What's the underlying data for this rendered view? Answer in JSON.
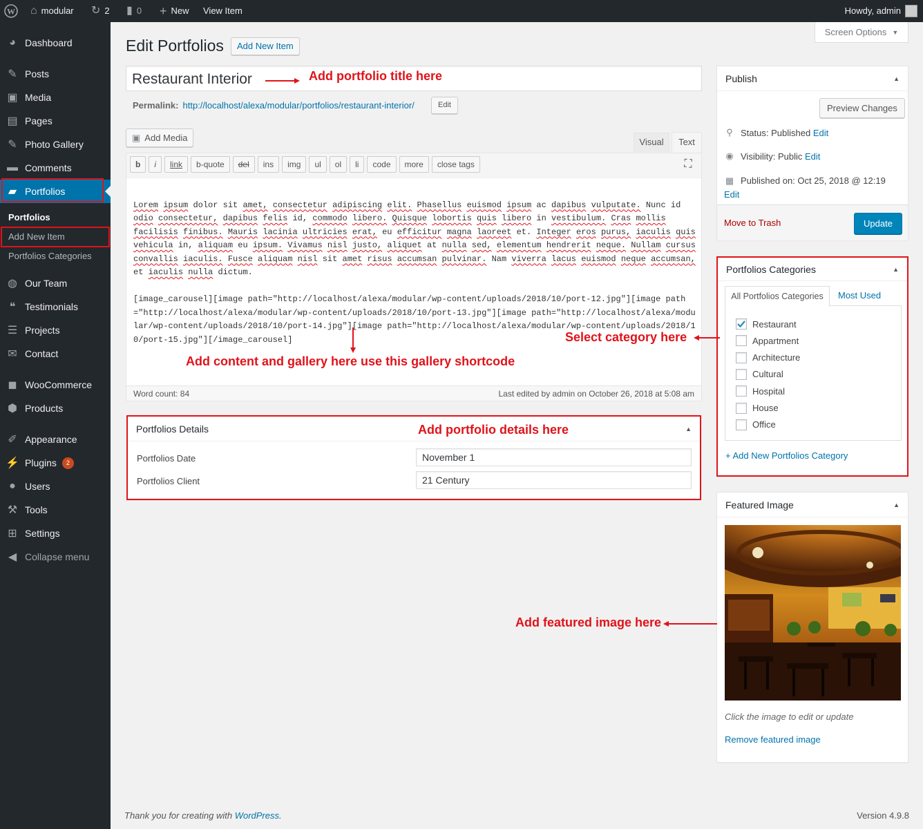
{
  "adminbar": {
    "site_name": "modular",
    "updates_count": "2",
    "comments_count": "0",
    "new_label": "New",
    "view_item_label": "View Item",
    "howdy": "Howdy, admin"
  },
  "sidebar": {
    "items": [
      {
        "label": "Dashboard",
        "icon": "dashboard-icon"
      },
      {
        "label": "Posts",
        "icon": "pin-icon"
      },
      {
        "label": "Media",
        "icon": "media-icon"
      },
      {
        "label": "Pages",
        "icon": "pages-icon"
      },
      {
        "label": "Photo Gallery",
        "icon": "pin-icon"
      },
      {
        "label": "Comments",
        "icon": "comment-icon"
      },
      {
        "label": "Portfolios",
        "icon": "folder-icon"
      },
      {
        "label": "Our Team",
        "icon": "team-icon"
      },
      {
        "label": "Testimonials",
        "icon": "quote-icon"
      },
      {
        "label": "Projects",
        "icon": "list-icon"
      },
      {
        "label": "Contact",
        "icon": "mail-icon"
      },
      {
        "label": "WooCommerce",
        "icon": "woo-icon"
      },
      {
        "label": "Products",
        "icon": "box-icon"
      },
      {
        "label": "Appearance",
        "icon": "brush-icon"
      },
      {
        "label": "Plugins",
        "icon": "plug-icon",
        "badge": "2"
      },
      {
        "label": "Users",
        "icon": "user-icon"
      },
      {
        "label": "Tools",
        "icon": "wrench-icon"
      },
      {
        "label": "Settings",
        "icon": "settings-icon"
      },
      {
        "label": "Collapse menu",
        "icon": "collapse-icon"
      }
    ],
    "submenu": [
      "Portfolios",
      "Add New Item",
      "Portfolios Categories"
    ]
  },
  "page": {
    "title": "Edit Portfolios",
    "add_new": "Add New Item",
    "screen_options": "Screen Options",
    "post_title": "Restaurant Interior",
    "permalink_label": "Permalink:",
    "permalink_base": "http://localhost/alexa/modular/portfolios/",
    "permalink_slug": "restaurant-interior",
    "permalink_end": "/",
    "permalink_edit": "Edit"
  },
  "editor": {
    "add_media": "Add Media",
    "tab_visual": "Visual",
    "tab_text": "Text",
    "quicktags": [
      "b",
      "i",
      "link",
      "b-quote",
      "del",
      "ins",
      "img",
      "ul",
      "ol",
      "li",
      "code",
      "more",
      "close tags"
    ],
    "paragraph": "Lorem ipsum dolor sit amet, consectetur adipiscing elit. Phasellus euismod ipsum ac dapibus vulputate. Nunc id odio consectetur, dapibus felis id, commodo libero. Quisque lobortis quis libero in vestibulum. Cras mollis facilisis finibus. Mauris lacinia ultricies erat, eu efficitur magna laoreet et. Integer eros purus, iaculis quis vehicula in, aliquam eu ipsum. Vivamus nisl justo, aliquet at nulla sed, elementum hendrerit neque. Nullam cursus convallis iaculis. Fusce aliquam nisl sit amet risus accumsan pulvinar. Nam viverra lacus euismod neque accumsan, et iaculis nulla dictum.",
    "shortcode": "[image_carousel][image path=\"http://localhost/alexa/modular/wp-content/uploads/2018/10/port-12.jpg\"][image path=\"http://localhost/alexa/modular/wp-content/uploads/2018/10/port-13.jpg\"][image path=\"http://localhost/alexa/modular/wp-content/uploads/2018/10/port-14.jpg\"][image path=\"http://localhost/alexa/modular/wp-content/uploads/2018/10/port-15.jpg\"][/image_carousel]",
    "word_count": "Word count: 84",
    "last_edited": "Last edited by admin on October 26, 2018 at 5:08 am"
  },
  "details": {
    "title": "Portfolios Details",
    "date_label": "Portfolios Date",
    "date_value": "November 1",
    "client_label": "Portfolios Client",
    "client_value": "21 Century"
  },
  "publish": {
    "title": "Publish",
    "preview": "Preview Changes",
    "status_label": "Status: ",
    "status_value": "Published",
    "visibility_label": "Visibility: ",
    "visibility_value": "Public",
    "published_label": "Published on: ",
    "published_value": "Oct 25, 2018 @ 12:19",
    "edit": "Edit",
    "trash": "Move to Trash",
    "update": "Update"
  },
  "categories": {
    "title": "Portfolios Categories",
    "tab_all": "All Portfolios Categories",
    "tab_most": "Most Used",
    "items": [
      {
        "label": "Restaurant",
        "checked": true
      },
      {
        "label": "Appartment",
        "checked": false
      },
      {
        "label": "Architecture",
        "checked": false
      },
      {
        "label": "Cultural",
        "checked": false
      },
      {
        "label": "Hospital",
        "checked": false
      },
      {
        "label": "House",
        "checked": false
      },
      {
        "label": "Office",
        "checked": false
      }
    ],
    "add_new": "+ Add New Portfolios Category"
  },
  "featured": {
    "title": "Featured Image",
    "hint": "Click the image to edit or update",
    "remove": "Remove featured image"
  },
  "annotations": {
    "title": "Add portfolio title here",
    "content": "Add content and gallery here use this gallery shortcode",
    "details": "Add portfolio details here",
    "category": "Select category here",
    "featured": "Add featured image here"
  },
  "footer": {
    "thanks_prefix": "Thank you for creating with ",
    "thanks_link": "WordPress",
    "thanks_suffix": ".",
    "version": "Version 4.9.8"
  },
  "colors": {
    "accent": "#0073aa",
    "annotation": "#e0131a",
    "sidebar": "#23282d"
  }
}
